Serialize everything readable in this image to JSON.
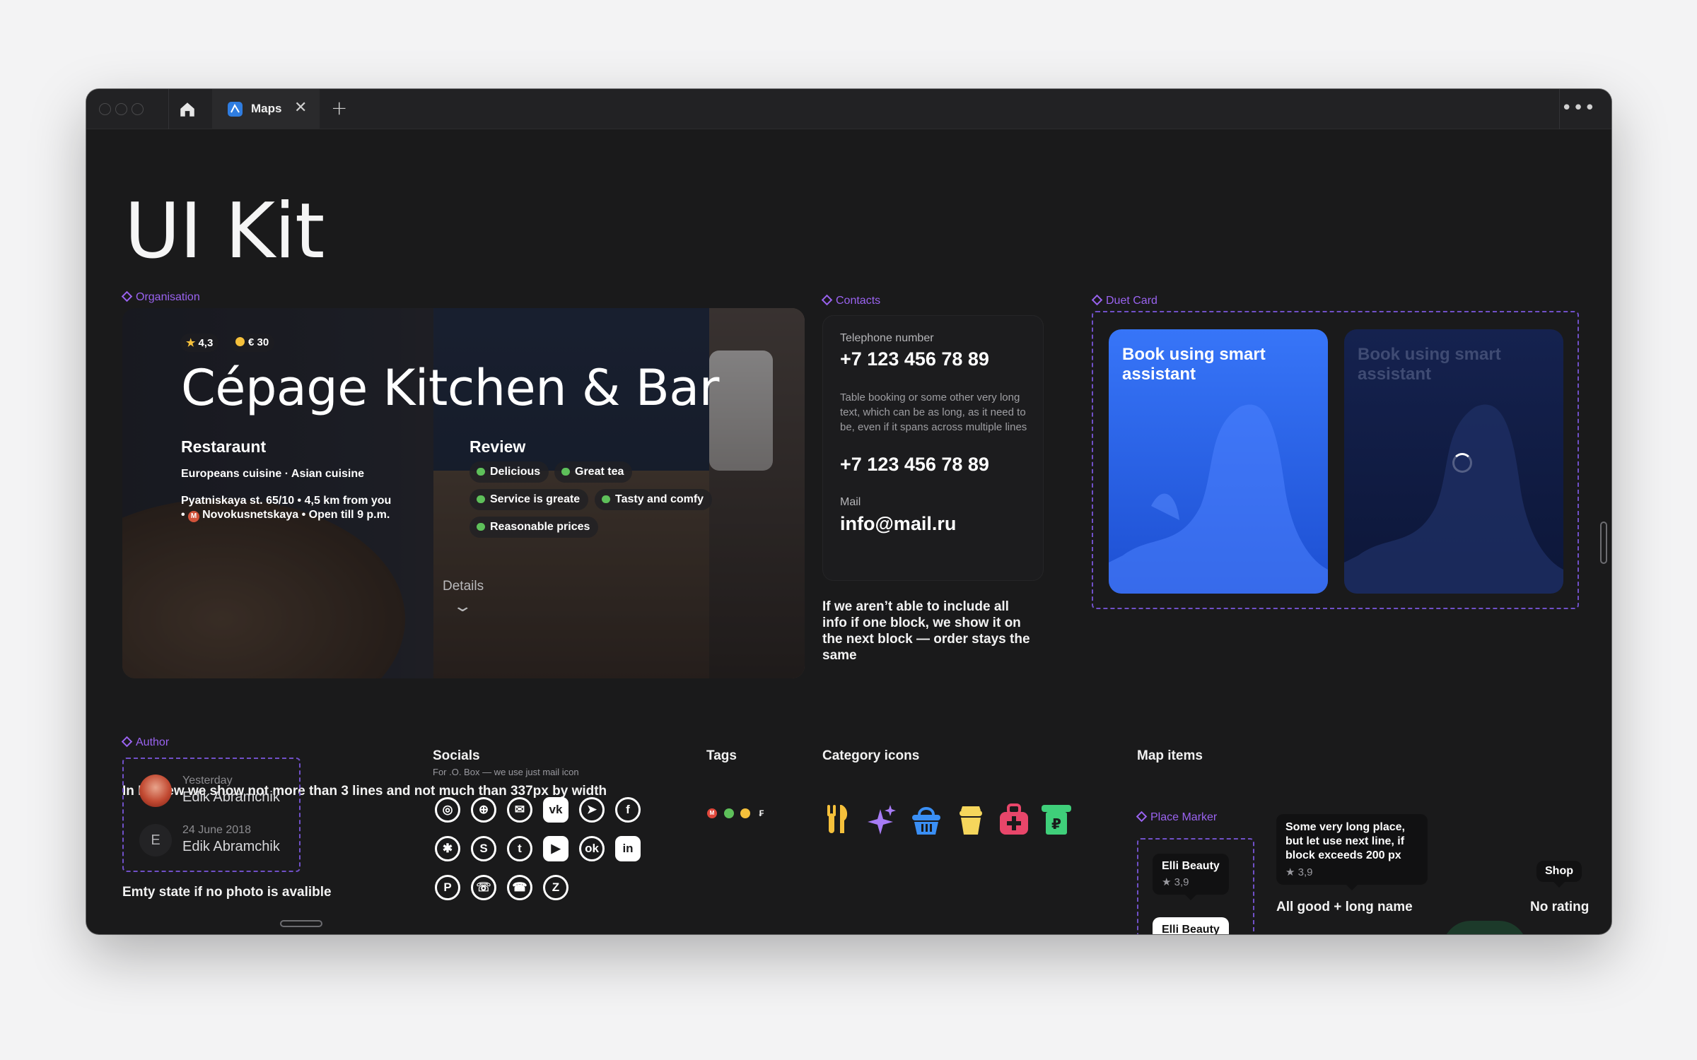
{
  "window": {
    "tab_label": "Maps",
    "tab_close": "✕",
    "tab_add": "+",
    "more": "•••"
  },
  "page": {
    "title": "UI Kit"
  },
  "organisation": {
    "component_label": "Organisation",
    "rating": "4,3",
    "price": "€ 30",
    "name": "Cépage Kitchen & Bar",
    "category": "Restaraunt",
    "cuisine": "Europeans cuisine · Asian cuisine",
    "address_line1": "Pyatniskaya st. 65/10 • 4,5 km from you",
    "address_line2_prefix": "•",
    "metro_letter": "M",
    "address_line2": "Novokusnetskaya • Open till 9 p.m.",
    "review_title": "Review",
    "reviews": [
      "Delicious",
      "Great tea",
      "Service is greate",
      "Tasty and comfy",
      "Reasonable prices"
    ],
    "details_label": "Details",
    "note": "In Review we show not more than 3 lines and not much than 337px by width"
  },
  "contacts": {
    "component_label": "Contacts",
    "phone_label": "Telephone number",
    "phone1": "+7 123 456 78 89",
    "description": "Table booking or some other very long text, which can be as long, as it need to be, even if it spans across multiple lines",
    "phone2": "+7 123 456 78 89",
    "mail_label": "Mail",
    "mail": "info@mail.ru",
    "note": "If we aren’t able to include all info if one block, we show it on the next block — order stays the same"
  },
  "duet": {
    "component_label": "Duet Card",
    "card1_title": "Book using smart assistant",
    "card2_title": "Book using smart assistant",
    "card1_color": "#2d6bf0",
    "card2_color": "#0e1c52"
  },
  "author": {
    "component_label": "Author",
    "entry1_date": "Yesterday",
    "entry1_name": "Edik Abramchik",
    "entry2_initial": "E",
    "entry2_date": "24 June 2018",
    "entry2_name": "Edik Abramchik",
    "note": "Emty state if no photo is avalible"
  },
  "socials": {
    "title": "Socials",
    "subtitle": "For .O. Box — we use just mail icon",
    "icons": [
      "instagram-icon",
      "globe-icon",
      "mail-icon",
      "vk-icon",
      "telegram-icon",
      "facebook-icon",
      "yelp-icon",
      "skype-icon",
      "twitter-icon",
      "youtube-icon",
      "odnoklassniki-icon",
      "linkedin-icon",
      "pinterest-icon",
      "whatsapp-icon",
      "viber-icon",
      "yandex-zen-icon"
    ]
  },
  "tags": {
    "title": "Tags",
    "items": [
      "metro-tag-icon",
      "chat-tag-icon",
      "thumb-tag-icon",
      "ruble-tag-icon"
    ]
  },
  "category_icons": {
    "title": "Category icons",
    "items": [
      "restaurant-icon",
      "sparkle-icon",
      "basket-icon",
      "cup-icon",
      "first-aid-icon",
      "payment-terminal-icon"
    ],
    "colors": [
      "#f5c03b",
      "#a77bf5",
      "#3a8ff5",
      "#f5d65c",
      "#e8466a",
      "#3fcf7a"
    ]
  },
  "map_items": {
    "title": "Map items",
    "marker_label": "Place Marker",
    "marker1_name": "Elli Beauty",
    "marker1_rating": "3,9",
    "marker2_name": "Elli Beauty",
    "long_name": "Some very long place, but let use next line, if block exceeds 200 px",
    "long_rating": "3,9",
    "caption_good": "All good",
    "caption_long": "+ long name",
    "shop_name": "Shop",
    "caption_norating": "No rating"
  }
}
